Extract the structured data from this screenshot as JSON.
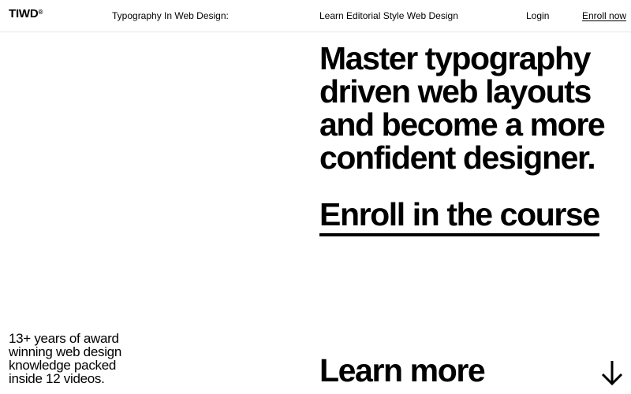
{
  "header": {
    "logo_text": "TIWD",
    "logo_mark": "®",
    "nav_title": "Typography In Web Design:",
    "nav_subtitle": "Learn Editorial Style Web Design",
    "login_label": "Login",
    "enroll_label": "Enroll now"
  },
  "hero": {
    "headline_lines": [
      "Master typography",
      "driven web layouts",
      "and become a more",
      "confident designer."
    ],
    "cta_label": "Enroll in the course"
  },
  "footer": {
    "blurb_lines": [
      "13+ years of award",
      "winning web design",
      "knowledge packed",
      "inside 12 videos."
    ],
    "learn_more_label": "Learn more",
    "arrow_icon": "arrow-down-icon"
  }
}
